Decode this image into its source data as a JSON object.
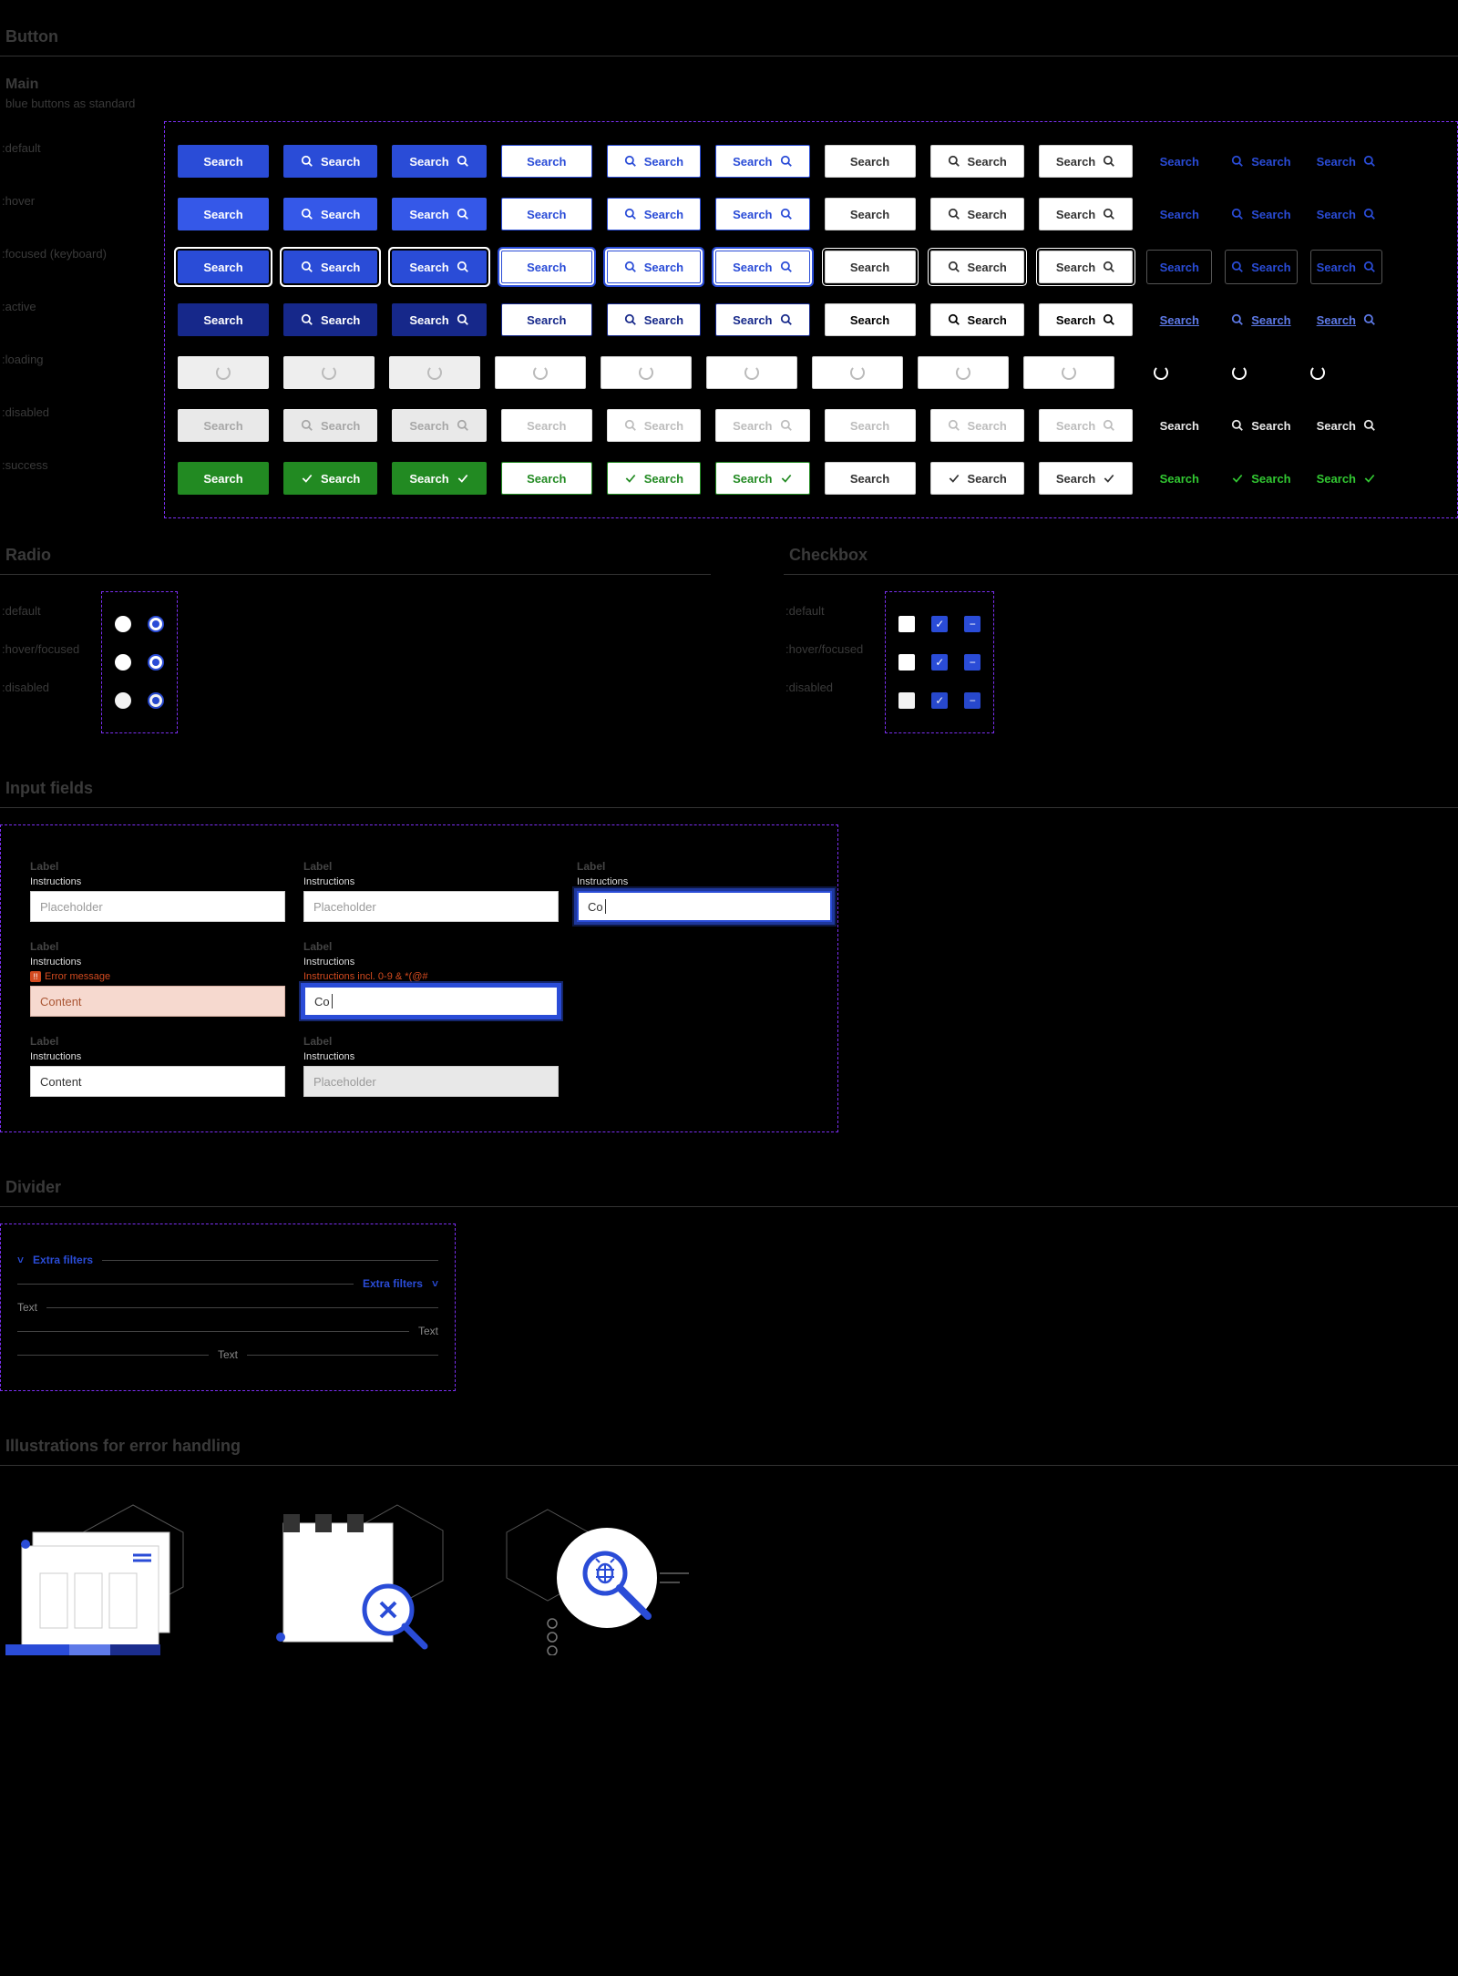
{
  "button": {
    "section_title": "Button",
    "main_title": "Main",
    "main_desc": "blue buttons as standard",
    "states": [
      ":default",
      ":hover",
      ":focused (keyboard)",
      ":active",
      ":loading",
      ":disabled",
      ":success"
    ],
    "label": "Search",
    "icon": "search-icon",
    "success_icon": "check-icon",
    "colors": {
      "primary": "#2a4cd7",
      "primary_active": "#16288a",
      "success": "#228a22"
    }
  },
  "radio": {
    "section_title": "Radio",
    "states": [
      ":default",
      ":hover/focused",
      ":disabled"
    ]
  },
  "checkbox": {
    "section_title": "Checkbox",
    "states": [
      ":default",
      ":hover/focused",
      ":disabled"
    ]
  },
  "inputs": {
    "section_title": "Input fields",
    "label": "Label",
    "instructions": "Instructions",
    "placeholder": "Placeholder",
    "content": "Content",
    "partial": "Co",
    "error_msg": "Error message",
    "error_instr": "Instructions incl. 0-9 & *(@#"
  },
  "divider": {
    "section_title": "Divider",
    "link_label": "Extra filters",
    "text_label": "Text"
  },
  "illustrations": {
    "section_title": "Illustrations for error handling"
  }
}
